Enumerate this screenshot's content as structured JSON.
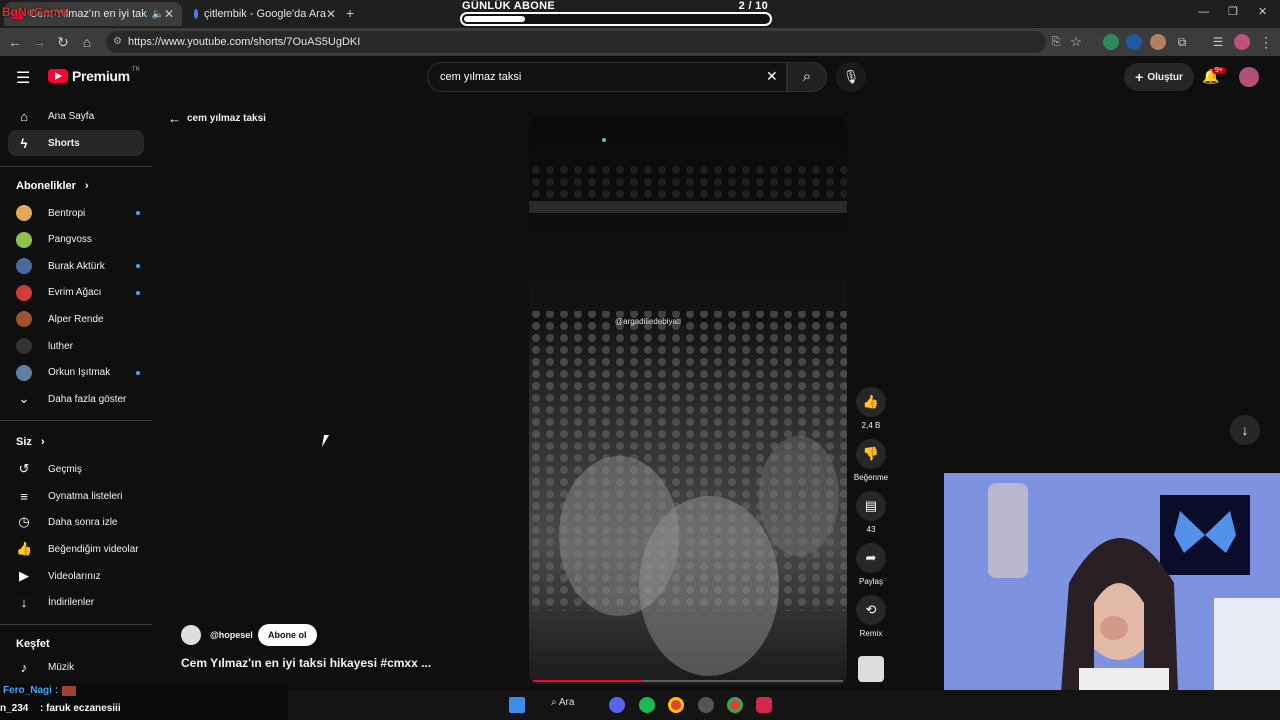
{
  "browser": {
    "tabs": [
      {
        "title": "Cem Yılmaz'ın en iyi taksi",
        "overlay_logo": "BgNoGame"
      },
      {
        "title": "çitlembik - Google'da Ara"
      }
    ],
    "url": "https://www.youtube.com/shorts/7OuAS5UgDKI"
  },
  "overlay": {
    "title": "GÜNLÜK ABONE",
    "count": "2 / 10",
    "progress": 0.2
  },
  "header": {
    "logo": "Premium",
    "region": "TR",
    "search_value": "cem yılmaz taksi",
    "create_label": "Oluştur",
    "notif_badge": "9+"
  },
  "sidebar": {
    "main": [
      {
        "label": "Ana Sayfa",
        "icon": "home-icon"
      },
      {
        "label": "Shorts",
        "icon": "shorts-icon"
      }
    ],
    "subs_title": "Abonelikler",
    "subs": [
      {
        "label": "Bentropi",
        "color": "#e0a85a",
        "new": true
      },
      {
        "label": "Pangvoss",
        "color": "#8bc34a",
        "new": false
      },
      {
        "label": "Burak Aktürk",
        "color": "#4a6a9a",
        "new": true
      },
      {
        "label": "Evrim Ağacı",
        "color": "#d23b3b",
        "new": true
      },
      {
        "label": "Alper Rende",
        "color": "#a0522d",
        "new": false
      },
      {
        "label": "luther",
        "color": "#333333",
        "new": false
      },
      {
        "label": "Orkun Işıtmak",
        "color": "#5f7fa0",
        "new": true
      }
    ],
    "more_label": "Daha fazla göster",
    "you_title": "Siz",
    "you": [
      {
        "label": "Geçmiş",
        "icon": "history-icon"
      },
      {
        "label": "Oynatma listeleri",
        "icon": "playlists-icon"
      },
      {
        "label": "Daha sonra izle",
        "icon": "watch-later-icon"
      },
      {
        "label": "Beğendiğim videolar",
        "icon": "liked-icon"
      },
      {
        "label": "Videolarınız",
        "icon": "your-videos-icon"
      },
      {
        "label": "İndirilenler",
        "icon": "downloads-icon"
      }
    ],
    "explore_title": "Keşfet",
    "explore": [
      {
        "label": "Müzik",
        "icon": "music-icon"
      }
    ]
  },
  "back": {
    "label": "cem yılmaz taksi"
  },
  "short": {
    "watermark": "@argadiliedebiyati",
    "channel": "@hopesel",
    "subscribe_label": "Abone ol",
    "title": "Cem Yılmaz'ın en iyi taksi hikayesi #cmxx ...",
    "progress": 0.35
  },
  "actions": {
    "likes": "2,4 B",
    "dislike": "Beğenme",
    "comments": "43",
    "share": "Paylaş",
    "remix": "Remix"
  },
  "chat": [
    {
      "user": "Fero_Nagi",
      "text": ":"
    },
    {
      "user": "n_234",
      "text": ": faruk eczanesiii"
    }
  ],
  "taskbar": {
    "search_label": "Ara"
  },
  "colors": {
    "yt_red": "#ff0033",
    "accent_blue": "#3ea6ff"
  }
}
